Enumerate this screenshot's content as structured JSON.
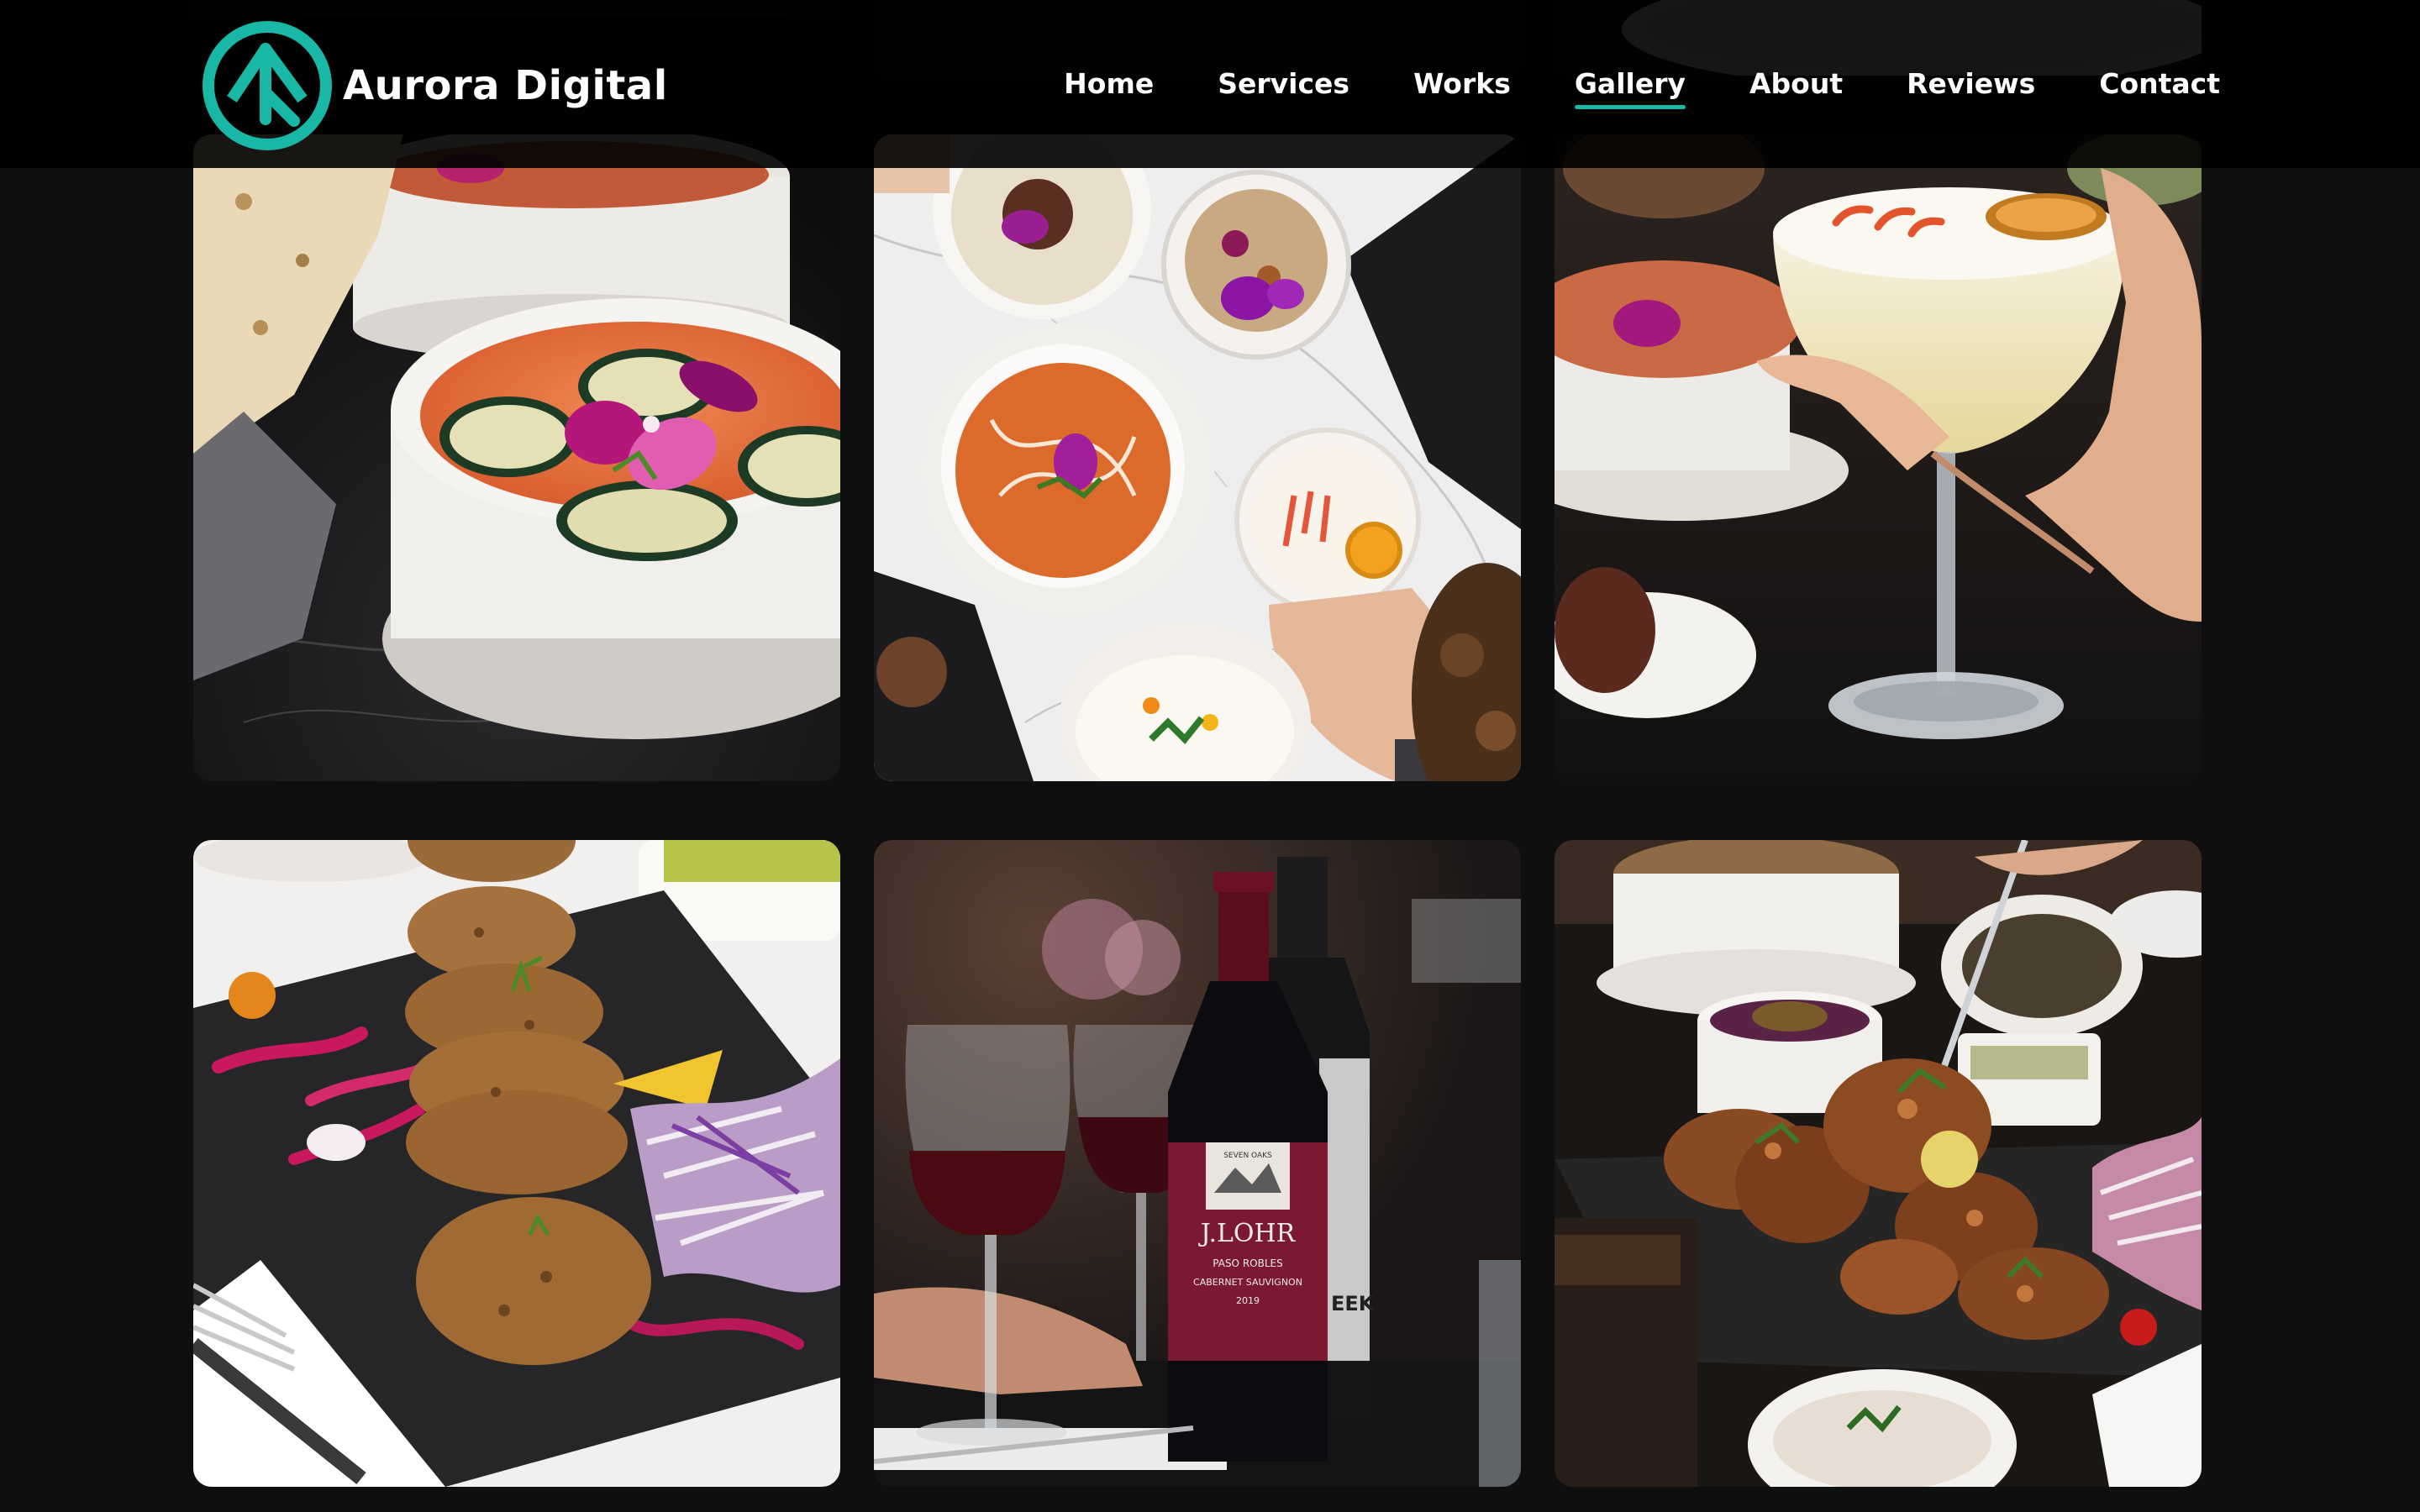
{
  "brand": {
    "name": "Aurora Digital",
    "accent_color": "#19b8a6",
    "logo_icon": "aurora-logo-icon"
  },
  "nav": {
    "active": "Gallery",
    "items": [
      {
        "label": "Home"
      },
      {
        "label": "Services"
      },
      {
        "label": "Works"
      },
      {
        "label": "Gallery"
      },
      {
        "label": "About"
      },
      {
        "label": "Reviews"
      },
      {
        "label": "Contact"
      }
    ]
  },
  "gallery": {
    "photos": [
      {
        "subject": "tomato soup with cucumber slices and orchid petals"
      },
      {
        "subject": "overhead table spread with curry, rice and cocktail"
      },
      {
        "subject": "hand holding frothy cocktail with dried citrus"
      },
      {
        "subject": "crispy cutlets on slate with slaw"
      },
      {
        "subject": "red wine bottles and glasses"
      },
      {
        "subject": "fried chicken platter with sauces"
      }
    ],
    "wine_label": {
      "brand": "J.LOHR",
      "line1": "PASO ROBLES",
      "line2": "CABERNET SAUVIGNON",
      "year": "2019",
      "small": "SEVEN OAKS"
    }
  }
}
